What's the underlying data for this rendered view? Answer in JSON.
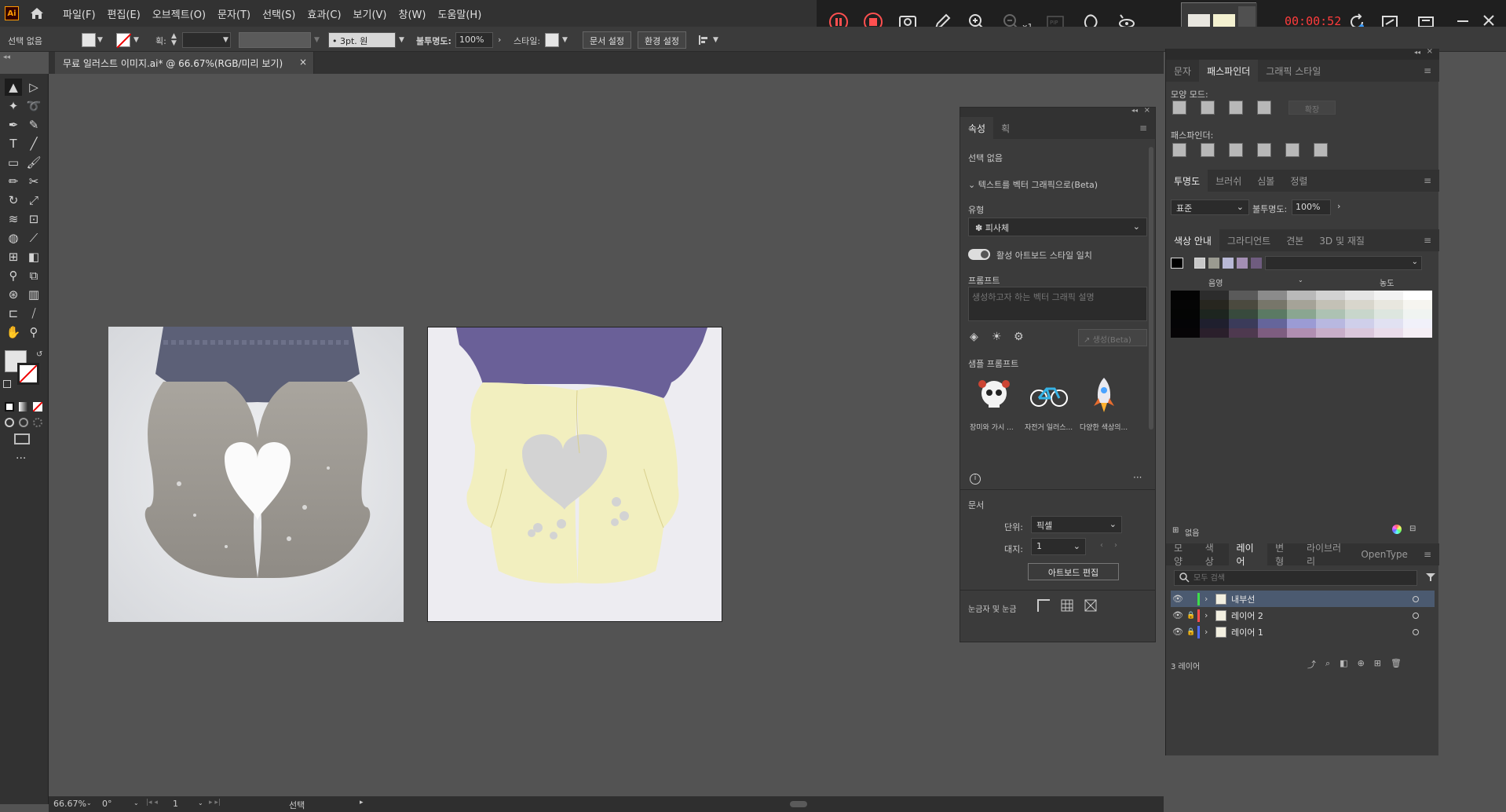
{
  "app": {
    "logo": "Ai",
    "menus": [
      "파일(F)",
      "편집(E)",
      "오브젝트(O)",
      "문자(T)",
      "선택(S)",
      "효과(C)",
      "보기(V)",
      "창(W)",
      "도움말(H)"
    ]
  },
  "recorder": {
    "time": "00:00:52",
    "speed": "x1",
    "icons": [
      "pause-icon",
      "stop-icon",
      "screenshot-icon",
      "pencil-icon",
      "zoom-in-icon",
      "zoom-out-icon",
      "pip-icon",
      "cursor-effect-icon",
      "spotlight-icon"
    ]
  },
  "controlbar": {
    "selection": "선택 없음",
    "stroke_label": "획:",
    "brush": "3pt. 원",
    "opacity_label": "불투명도:",
    "opacity": "100%",
    "style_label": "스타일:",
    "doc_setup": "문서 설정",
    "prefs": "환경 설정"
  },
  "document": {
    "tab_title": "무료 일러스트 이미지.ai* @ 66.67%(RGB/미리 보기)"
  },
  "statusbar": {
    "zoom": "66.67%",
    "rotation": "0°",
    "artboard_num": "1",
    "tool": "선택"
  },
  "properties": {
    "tabs": [
      "속성",
      "획"
    ],
    "selection": "선택 없음",
    "section_text_to_vector": "텍스트를 벡터 그래픽으로(Beta)",
    "type_label": "유형",
    "type_value": "피사체",
    "toggle_label": "활성 아트보드 스타일 일치",
    "prompt_label": "프롬프트",
    "prompt_placeholder": "생성하고자 하는 벡터 그래픽 설명",
    "generate": "생성(Beta)",
    "samples_label": "샘플 프롬프트",
    "samples": [
      "장미와 가시 ...",
      "자전거 일러스...",
      "다양한 색상의..."
    ],
    "doc_label": "문서",
    "unit_label": "단위:",
    "unit_value": "픽셀",
    "artboard_label": "대지:",
    "artboard_value": "1",
    "edit_artboard": "아트보드 편집",
    "rulers_label": "눈금자 및 눈금"
  },
  "pathfinder_panel": {
    "tabs": [
      "문자",
      "패스파인더",
      "그래픽 스타일"
    ],
    "shape_modes": "모양 모드:",
    "expand": "확장",
    "pathfinders": "패스파인더:"
  },
  "transparency_panel": {
    "tabs": [
      "투명도",
      "브러쉬",
      "심볼",
      "정렬"
    ],
    "mode": "표준",
    "opacity_label": "불투명도:",
    "opacity": "100%"
  },
  "color_guide": {
    "tabs": [
      "색상 안내",
      "그라디언트",
      "견본",
      "3D 및 재질"
    ],
    "shade": "음영",
    "tint": "농도",
    "footer": "없음",
    "harmony": [
      "#000000",
      "#c8c8c8",
      "#9a9a90",
      "#b9b9d6",
      "#a48fb4",
      "#6f5c7f"
    ],
    "grid": [
      [
        "#030303",
        "#2c2c2c",
        "#5a5a5a",
        "#8b8b8b",
        "#b9b9b9",
        "#d2d2d2",
        "#e5e5e5",
        "#f2f2f2",
        "#ffffff"
      ],
      [
        "#050505",
        "#27261f",
        "#4b4a3f",
        "#77766a",
        "#a5a398",
        "#c3c1b6",
        "#d8d6cc",
        "#e8e7df",
        "#f6f5f0"
      ],
      [
        "#040504",
        "#1d251f",
        "#384a3d",
        "#5b7a64",
        "#8aa691",
        "#adc2b3",
        "#c8d6cb",
        "#dde6df",
        "#f0f4f1"
      ],
      [
        "#040406",
        "#1f1f2e",
        "#3b3b5a",
        "#65659b",
        "#9b9bd4",
        "#b8b8e0",
        "#cfcfea",
        "#e1e1f2",
        "#f1f1fa"
      ],
      [
        "#060406",
        "#2a1f2b",
        "#4e394f",
        "#7e5d80",
        "#b08eb1",
        "#c8aec9",
        "#dac7db",
        "#e9dcea",
        "#f5eff5"
      ]
    ]
  },
  "layers_panel": {
    "tabs": [
      "모양",
      "색상",
      "레이어",
      "변형",
      "라이브러리",
      "OpenType"
    ],
    "search_placeholder": "모두 검색",
    "layers": [
      {
        "name": "내부선",
        "color": "#3ddc4a"
      },
      {
        "name": "레이어 2",
        "color": "#ff4d4d"
      },
      {
        "name": "레이어 1",
        "color": "#4d6bff"
      }
    ],
    "count": "3 레이어"
  },
  "artwork": {
    "sleeve_color": "#6a6098",
    "mitten_color": "#f2efbf",
    "heart_color": "#d3d3d3",
    "bg_color": "#edecf1"
  }
}
